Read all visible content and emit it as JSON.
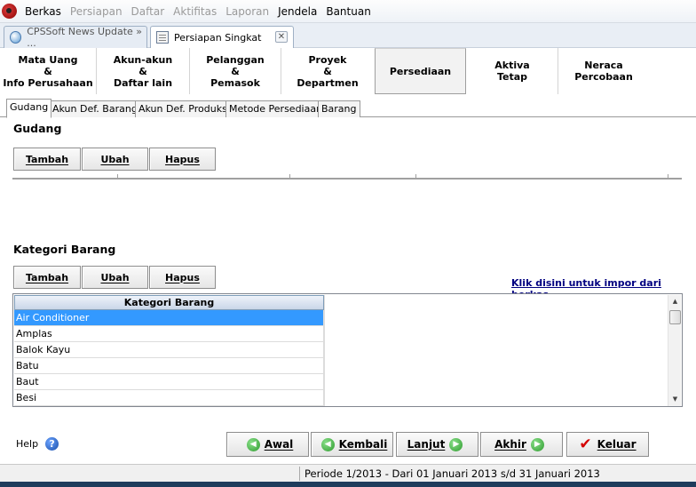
{
  "menu": {
    "items": [
      {
        "label": "Berkas",
        "enabled": true
      },
      {
        "label": "Persiapan",
        "enabled": false
      },
      {
        "label": "Daftar",
        "enabled": false
      },
      {
        "label": "Aktifitas",
        "enabled": false
      },
      {
        "label": "Laporan",
        "enabled": false
      },
      {
        "label": "Jendela",
        "enabled": true
      },
      {
        "label": "Bantuan",
        "enabled": true
      }
    ]
  },
  "doc_tabs": [
    {
      "label": "CPSSoft News Update » ...",
      "icon": "globe-icon"
    },
    {
      "label": "Persiapan Singkat",
      "icon": "page-icon",
      "active": true
    }
  ],
  "step_tabs": [
    {
      "label": "Mata Uang\n&\nInfo Perusahaan"
    },
    {
      "label": "Akun-akun\n&\nDaftar lain"
    },
    {
      "label": "Pelanggan\n&\nPemasok"
    },
    {
      "label": "Proyek\n&\nDepartmen"
    },
    {
      "label": "Persediaan",
      "active": true
    },
    {
      "label": "Aktiva\nTetap"
    },
    {
      "label": "Neraca\nPercobaan"
    }
  ],
  "sub_tabs": [
    {
      "label": "Gudang",
      "active": true
    },
    {
      "label": "Akun Def. Barang"
    },
    {
      "label": "Akun Def. Produksi"
    },
    {
      "label": "Metode Persediaan"
    },
    {
      "label": "Barang"
    }
  ],
  "gudang": {
    "title": "Gudang",
    "buttons": {
      "add": "Tambah",
      "edit": "Ubah",
      "delete": "Hapus"
    }
  },
  "kategori": {
    "title": "Kategori Barang",
    "buttons": {
      "add": "Tambah",
      "edit": "Ubah",
      "delete": "Hapus"
    },
    "import_link": "Klik disini untuk impor dari berkas",
    "column_header": "Kategori Barang",
    "rows": [
      "Air Conditioner",
      "Amplas",
      "Balok Kayu",
      "Batu",
      "Baut",
      "Besi"
    ],
    "selected_index": 0
  },
  "footer": {
    "help": "Help",
    "buttons": {
      "first": "Awal",
      "back": "Kembali",
      "next": "Lanjut",
      "last": "Akhir",
      "exit": "Keluar"
    }
  },
  "status": {
    "period": "Periode 1/2013 - Dari 01 Januari 2013 s/d 31 Januari 2013"
  },
  "colors": {
    "selection": "#3399ff",
    "link": "#000080",
    "exit_check": "#d40000",
    "nav_arrow": "#2e9b2e"
  }
}
